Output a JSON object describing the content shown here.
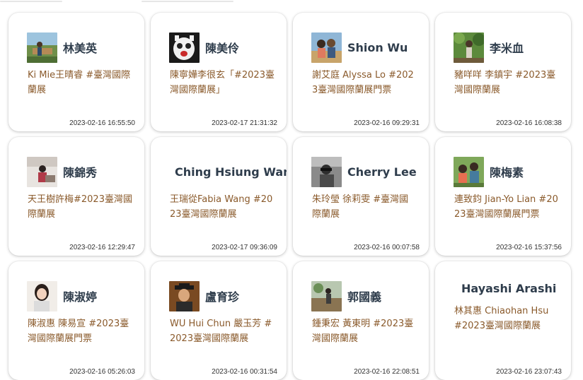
{
  "cards": [
    {
      "name": "林美英",
      "message": "Ki Mie王晴睿 #臺灣國際蘭展",
      "timestamp": "2023-02-16 16:55:50",
      "avatar": "avatar-photo-field"
    },
    {
      "name": "陳美伶",
      "message": "陳寧嬅李很玄「#2023臺灣國際蘭展」",
      "timestamp": "2023-02-17 21:31:32",
      "avatar": "avatar-photo-mask"
    },
    {
      "name": "Shion Wu",
      "message": "謝艾庭 Alyssa Lo #2023臺灣國際蘭展門票",
      "timestamp": "2023-02-16 09:29:31",
      "avatar": "avatar-photo-family"
    },
    {
      "name": "李米血",
      "message": "豬咩咩 李鎮宇 #2023臺灣國際蘭展",
      "timestamp": "2023-02-16 16:08:38",
      "avatar": "avatar-photo-garden"
    },
    {
      "name": "陳錦秀",
      "message": "天王樹許梅#2023臺灣國際蘭展",
      "timestamp": "2023-02-16 12:29:47",
      "avatar": "avatar-photo-room"
    },
    {
      "name": "Ching Hsiung Wang",
      "message": "王瑞從Fabia Wang #2023臺灣國際蘭展",
      "timestamp": "2023-02-17 09:36:09",
      "avatar": ""
    },
    {
      "name": "Cherry Lee",
      "message": "朱玲瑩 徐莉雯 #臺灣國際蘭展",
      "timestamp": "2023-02-16 00:07:58",
      "avatar": "avatar-photo-bw"
    },
    {
      "name": "陳梅素",
      "message": "連致鈞 Jian-Yo Lian #2023臺灣國際蘭展門票",
      "timestamp": "2023-02-16 15:37:56",
      "avatar": "avatar-photo-kids"
    },
    {
      "name": "陳淑婷",
      "message": "陳淑惠 陳易宣 #2023臺灣國際蘭展門票",
      "timestamp": "2023-02-16 05:26:03",
      "avatar": "avatar-photo-woman"
    },
    {
      "name": "盧育珍",
      "message": "WU Hui Chun 嚴玉芳 #2023臺灣國際蘭展",
      "timestamp": "2023-02-16 00:31:54",
      "avatar": "avatar-photo-graduate"
    },
    {
      "name": "郭國義",
      "message": "鍾秉宏 黃東明 #2023臺灣國際蘭展",
      "timestamp": "2023-02-16 22:08:51",
      "avatar": "avatar-photo-outdoor"
    },
    {
      "name": "Hayashi Arashi",
      "message": "林其惠 Chiaohan Hsu #2023臺灣國際蘭展",
      "timestamp": "2023-02-16 23:07:43",
      "avatar": "avatar-photo-tiny"
    }
  ]
}
